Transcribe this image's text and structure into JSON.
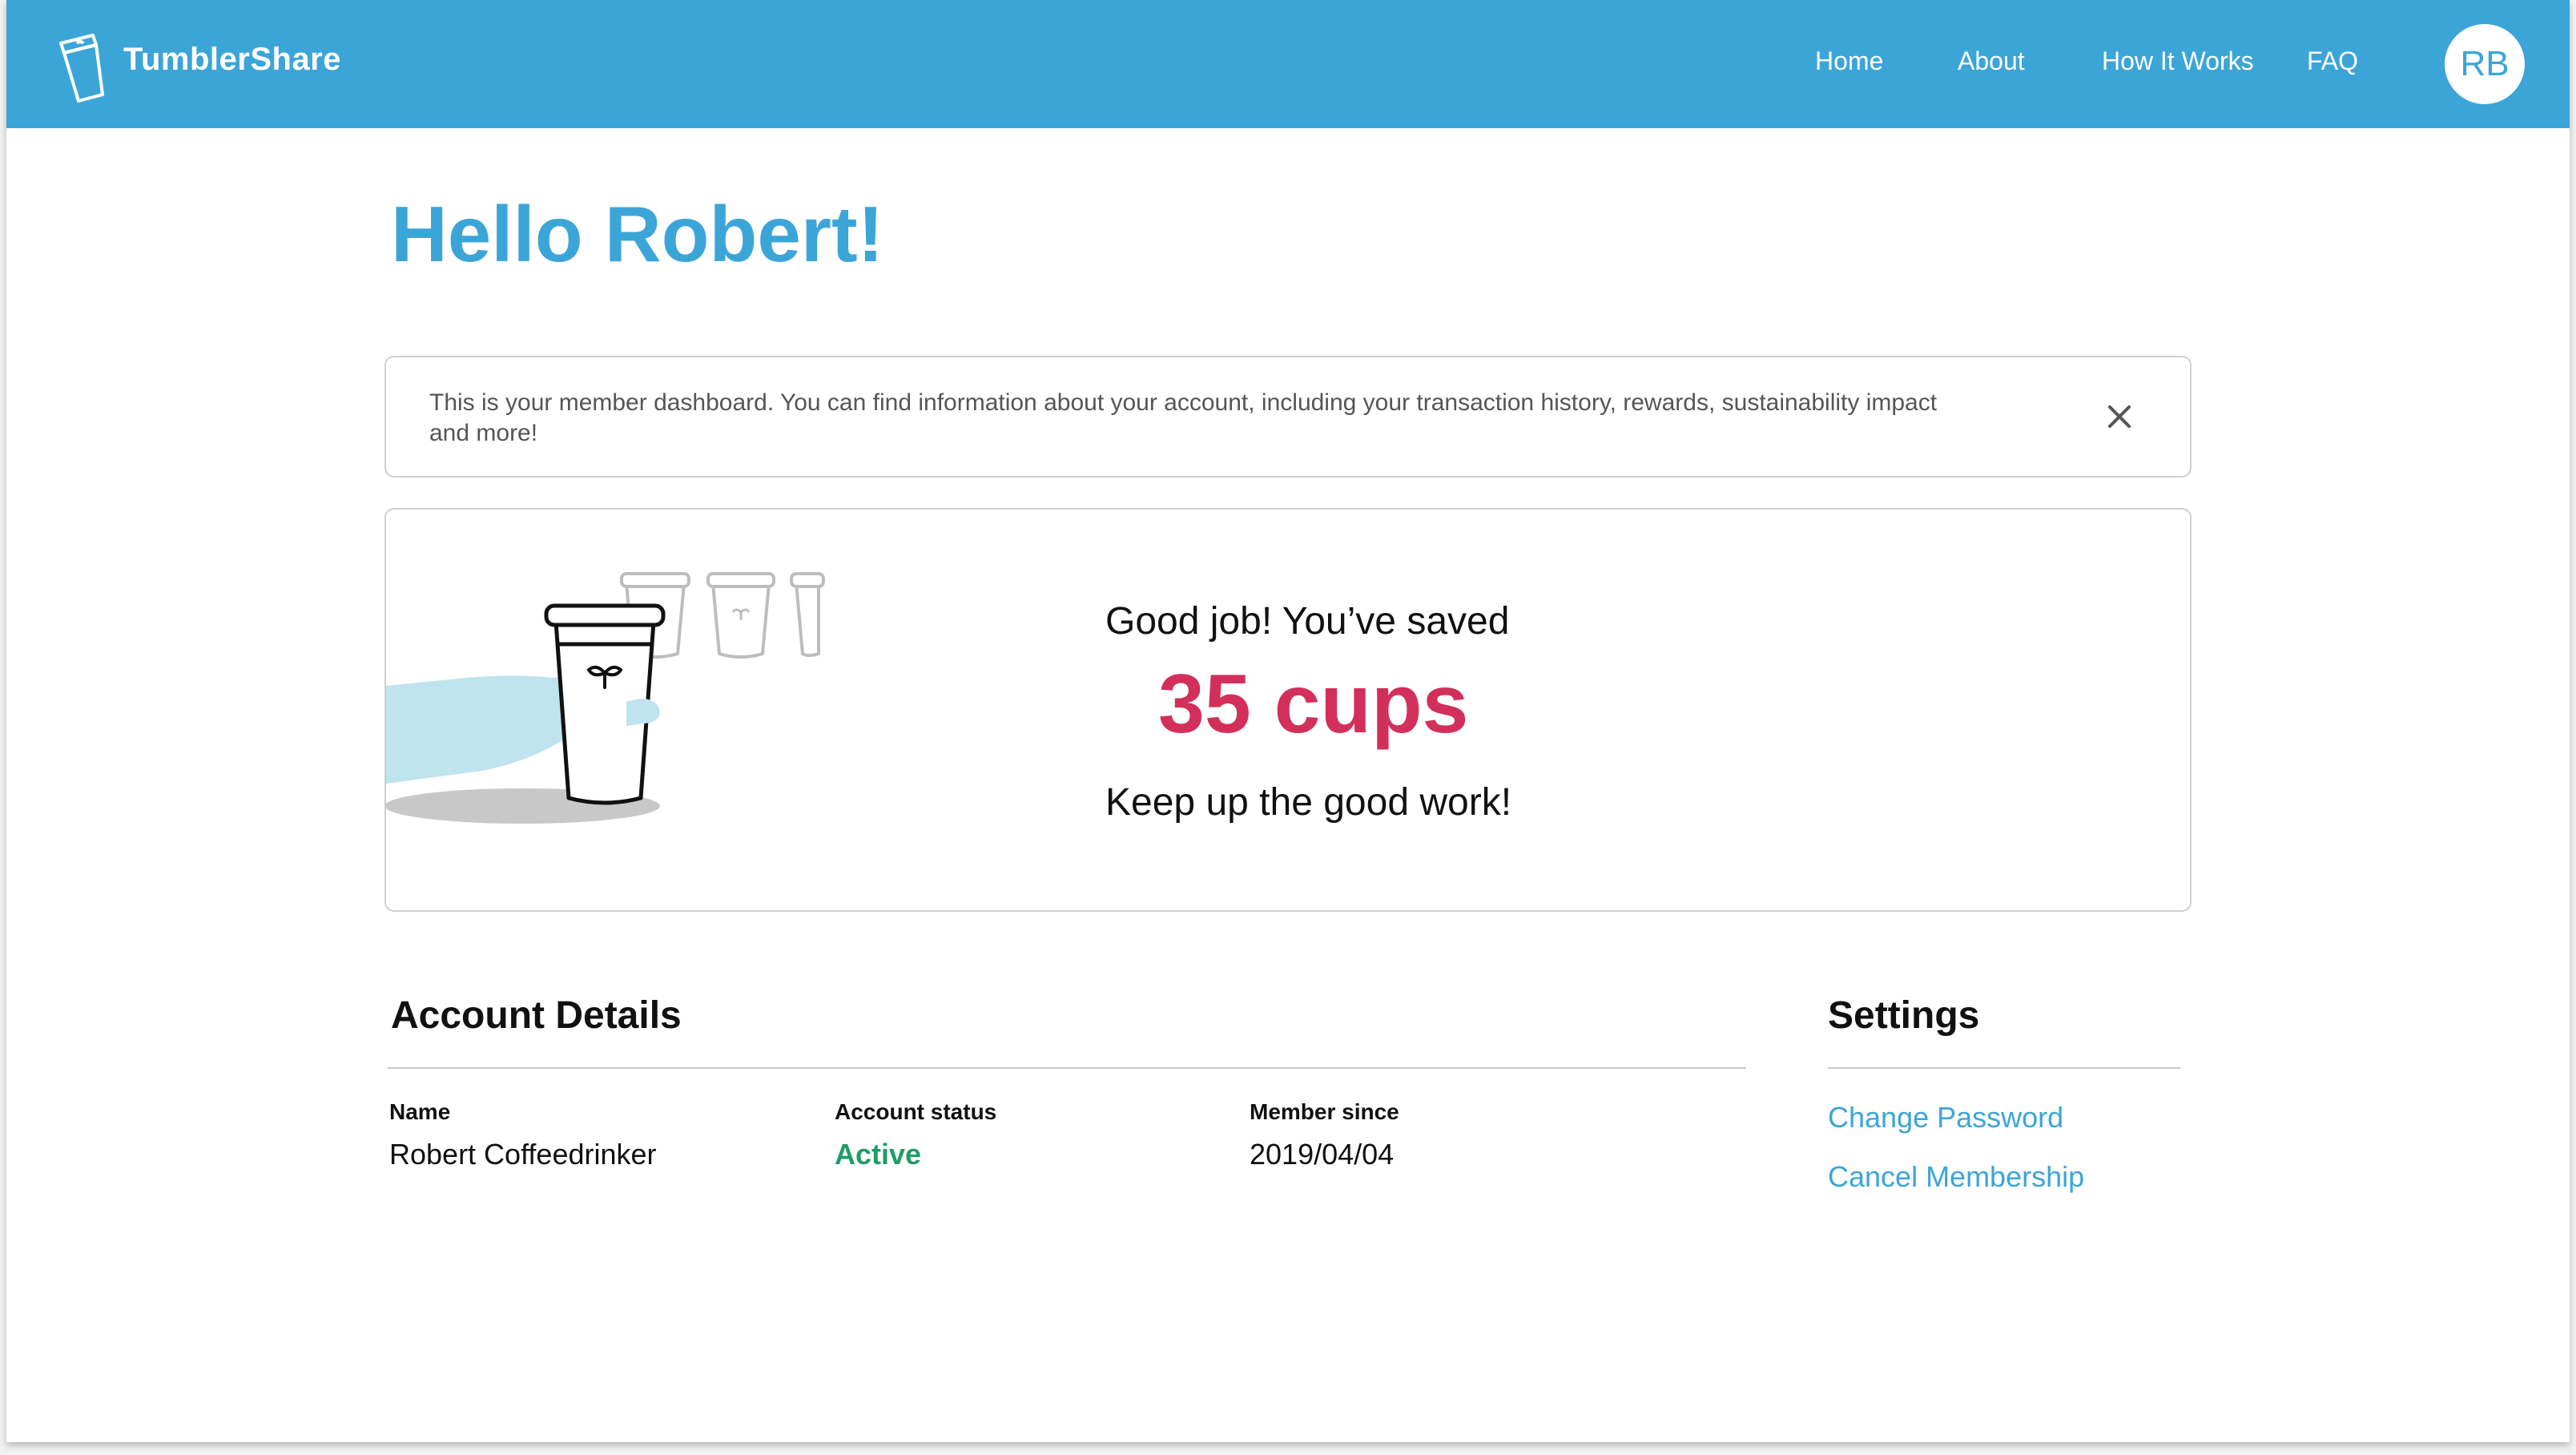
{
  "header": {
    "brand": "TumblerShare",
    "nav": [
      "Home",
      "About",
      "How It Works",
      "FAQ"
    ],
    "avatar_initials": "RB"
  },
  "greeting": "Hello Robert!",
  "banner": {
    "text": "This is your member dashboard. You can find information about your account, including your transaction history, rewards, sustainability impact and more!"
  },
  "savings": {
    "line1": "Good job! You’ve saved",
    "count": "35 cups",
    "line2": "Keep up the good work!"
  },
  "account": {
    "title": "Account Details",
    "name_label": "Name",
    "name_value": "Robert Coffeedrinker",
    "status_label": "Account status",
    "status_value": "Active",
    "since_label": "Member since",
    "since_value": "2019/04/04"
  },
  "settings": {
    "title": "Settings",
    "links": [
      "Change Password",
      "Cancel Membership"
    ]
  },
  "colors": {
    "brand_blue": "#3ca5d8",
    "count_red": "#d2305a",
    "active_green": "#1f9c68"
  }
}
